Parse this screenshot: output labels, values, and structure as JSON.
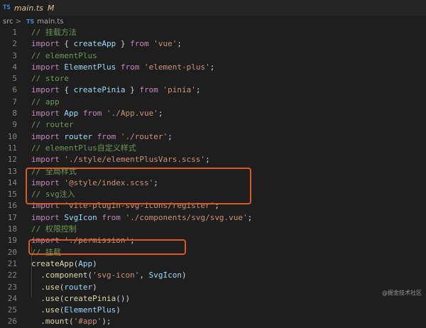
{
  "tab": {
    "lang_badge": "TS",
    "file_name": "main.ts",
    "status": "M"
  },
  "breadcrumb": {
    "folder": "src",
    "separator": ">",
    "lang_badge": "TS",
    "file": "main.ts"
  },
  "code": {
    "lines": [
      {
        "n": "1",
        "parts": [
          [
            "cm",
            "// 挂载方法"
          ]
        ]
      },
      {
        "n": "2",
        "parts": [
          [
            "kw",
            "import"
          ],
          [
            "pun",
            " { "
          ],
          [
            "id",
            "createApp"
          ],
          [
            "pun",
            " } "
          ],
          [
            "kw",
            "from"
          ],
          [
            "pun",
            " "
          ],
          [
            "str",
            "'vue'"
          ],
          [
            "pun",
            ";"
          ]
        ]
      },
      {
        "n": "3",
        "parts": [
          [
            "cm",
            "// elementPlus"
          ]
        ]
      },
      {
        "n": "4",
        "parts": [
          [
            "kw",
            "import"
          ],
          [
            "pun",
            " "
          ],
          [
            "id",
            "ElementPlus"
          ],
          [
            "pun",
            " "
          ],
          [
            "kw",
            "from"
          ],
          [
            "pun",
            " "
          ],
          [
            "str",
            "'element-plus'"
          ],
          [
            "pun",
            ";"
          ]
        ]
      },
      {
        "n": "5",
        "parts": [
          [
            "cm",
            "// store"
          ]
        ]
      },
      {
        "n": "6",
        "parts": [
          [
            "kw",
            "import"
          ],
          [
            "pun",
            " { "
          ],
          [
            "id",
            "createPinia"
          ],
          [
            "pun",
            " } "
          ],
          [
            "kw",
            "from"
          ],
          [
            "pun",
            " "
          ],
          [
            "str",
            "'pinia'"
          ],
          [
            "pun",
            ";"
          ]
        ]
      },
      {
        "n": "7",
        "parts": [
          [
            "cm",
            "// app"
          ]
        ]
      },
      {
        "n": "8",
        "parts": [
          [
            "kw",
            "import"
          ],
          [
            "pun",
            " "
          ],
          [
            "id",
            "App"
          ],
          [
            "pun",
            " "
          ],
          [
            "kw",
            "from"
          ],
          [
            "pun",
            " "
          ],
          [
            "str",
            "'./App.vue'"
          ],
          [
            "pun",
            ";"
          ]
        ]
      },
      {
        "n": "9",
        "parts": [
          [
            "cm",
            "// router"
          ]
        ]
      },
      {
        "n": "10",
        "parts": [
          [
            "kw",
            "import"
          ],
          [
            "pun",
            " "
          ],
          [
            "id",
            "router"
          ],
          [
            "pun",
            " "
          ],
          [
            "kw",
            "from"
          ],
          [
            "pun",
            " "
          ],
          [
            "str",
            "'./router'"
          ],
          [
            "pun",
            ";"
          ]
        ]
      },
      {
        "n": "11",
        "parts": [
          [
            "cm",
            "// elementPlus自定义样式"
          ]
        ]
      },
      {
        "n": "12",
        "parts": [
          [
            "kw",
            "import"
          ],
          [
            "pun",
            " "
          ],
          [
            "str",
            "'./style/elementPlusVars.scss'"
          ],
          [
            "pun",
            ";"
          ]
        ]
      },
      {
        "n": "13",
        "parts": [
          [
            "cm",
            "// 全局样式"
          ]
        ]
      },
      {
        "n": "14",
        "parts": [
          [
            "kw",
            "import"
          ],
          [
            "pun",
            " "
          ],
          [
            "str",
            "'@style/index.scss'"
          ],
          [
            "pun",
            ";"
          ]
        ]
      },
      {
        "n": "15",
        "parts": [
          [
            "cm",
            "// svg注入"
          ]
        ]
      },
      {
        "n": "16",
        "parts": [
          [
            "kw",
            "import"
          ],
          [
            "pun",
            " "
          ],
          [
            "str",
            "'vite-plugin-svg-icons/register'"
          ],
          [
            "pun",
            ";"
          ]
        ]
      },
      {
        "n": "17",
        "parts": [
          [
            "kw",
            "import"
          ],
          [
            "pun",
            " "
          ],
          [
            "id",
            "SvgIcon"
          ],
          [
            "pun",
            " "
          ],
          [
            "kw",
            "from"
          ],
          [
            "pun",
            " "
          ],
          [
            "str",
            "'./components/svg/svg.vue'"
          ],
          [
            "pun",
            ";"
          ]
        ]
      },
      {
        "n": "18",
        "parts": [
          [
            "cm",
            "// 权限控制"
          ]
        ]
      },
      {
        "n": "19",
        "parts": [
          [
            "kw",
            "import"
          ],
          [
            "pun",
            " "
          ],
          [
            "str",
            "'./permission'"
          ],
          [
            "pun",
            ";"
          ]
        ]
      },
      {
        "n": "20",
        "parts": [
          [
            "cm",
            "// 挂载"
          ]
        ]
      },
      {
        "n": "21",
        "parts": [
          [
            "fn",
            "createApp"
          ],
          [
            "pun",
            "("
          ],
          [
            "id",
            "App"
          ],
          [
            "pun",
            ")"
          ]
        ]
      },
      {
        "n": "22",
        "parts": [
          [
            "pun",
            "  ."
          ],
          [
            "fn",
            "component"
          ],
          [
            "pun",
            "("
          ],
          [
            "str",
            "'svg-icon'"
          ],
          [
            "pun",
            ", "
          ],
          [
            "id",
            "SvgIcon"
          ],
          [
            "pun",
            ")"
          ]
        ]
      },
      {
        "n": "23",
        "parts": [
          [
            "pun",
            "  ."
          ],
          [
            "fn",
            "use"
          ],
          [
            "pun",
            "("
          ],
          [
            "id",
            "router"
          ],
          [
            "pun",
            ")"
          ]
        ]
      },
      {
        "n": "24",
        "parts": [
          [
            "pun",
            "  ."
          ],
          [
            "fn",
            "use"
          ],
          [
            "pun",
            "("
          ],
          [
            "fn",
            "createPinia"
          ],
          [
            "pun",
            "())"
          ]
        ]
      },
      {
        "n": "25",
        "parts": [
          [
            "pun",
            "  ."
          ],
          [
            "fn",
            "use"
          ],
          [
            "pun",
            "("
          ],
          [
            "id",
            "ElementPlus"
          ],
          [
            "pun",
            ")"
          ]
        ]
      },
      {
        "n": "26",
        "parts": [
          [
            "pun",
            "  ."
          ],
          [
            "fn",
            "mount"
          ],
          [
            "pun",
            "("
          ],
          [
            "str",
            "'#app'"
          ],
          [
            "pun",
            ");"
          ]
        ]
      }
    ]
  },
  "highlight_color": "#d8591e",
  "watermark": "@掘金技术社区"
}
